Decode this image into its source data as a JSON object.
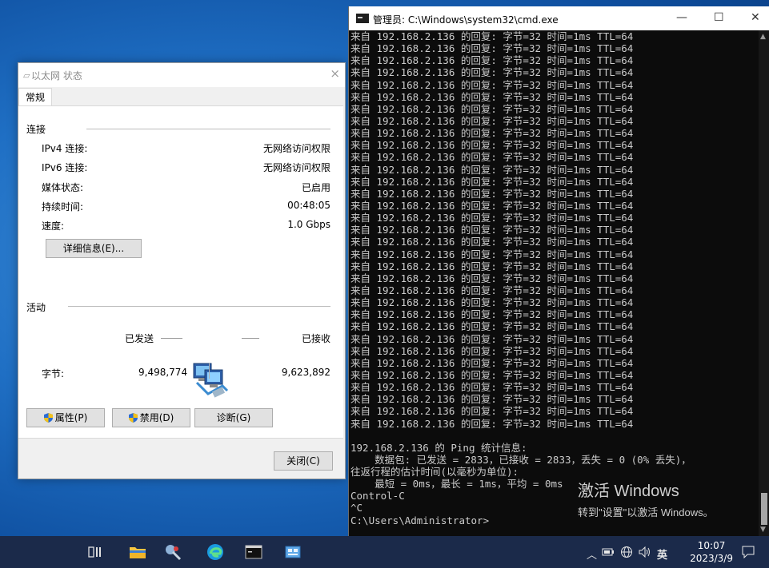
{
  "dialog": {
    "title": "以太网 状态",
    "close_glyph": "×",
    "tab": "常规",
    "connection": {
      "heading": "连接",
      "rows": [
        {
          "label": "IPv4 连接:",
          "value": "无网络访问权限"
        },
        {
          "label": "IPv6 连接:",
          "value": "无网络访问权限"
        },
        {
          "label": "媒体状态:",
          "value": "已启用"
        },
        {
          "label": "持续时间:",
          "value": "00:48:05"
        },
        {
          "label": "速度:",
          "value": "1.0 Gbps"
        }
      ],
      "details_button": "详细信息(E)..."
    },
    "activity": {
      "heading": "活动",
      "sent_label": "已发送",
      "received_label": "已接收",
      "bytes_label": "字节:",
      "bytes_sent": "9,498,774",
      "bytes_received": "9,623,892"
    },
    "buttons": {
      "properties": "属性(P)",
      "disable": "禁用(D)",
      "diagnose": "诊断(G)",
      "close": "关闭(C)"
    }
  },
  "cmd": {
    "title": "管理员: C:\\Windows\\system32\\cmd.exe",
    "controls": {
      "minimize": "—",
      "maximize": "☐",
      "close": "✕"
    },
    "reply_line": "来自 192.168.2.136 的回复: 字节=32 时间=1ms TTL=64",
    "reply_count": 33,
    "tail_lines": [
      "",
      "192.168.2.136 的 Ping 统计信息:",
      "    数据包: 已发送 = 2833，已接收 = 2833，丢失 = 0 (0% 丢失)，",
      "往返行程的估计时间(以毫秒为单位):",
      "    最短 = 0ms，最长 = 1ms，平均 = 0ms",
      "Control-C",
      "^C",
      "C:\\Users\\Administrator>"
    ],
    "watermark_title": "激活 Windows",
    "watermark_sub": "转到\"设置\"以激活 Windows。"
  },
  "taskbar": {
    "icons": [
      "task-view-icon",
      "file-explorer-icon",
      "network-tool-icon",
      "edge-browser-icon",
      "cmd-icon",
      "control-panel-icon"
    ],
    "tray": {
      "chevron": "︿",
      "input_method": "英"
    },
    "time": "10:07",
    "date": "2023/3/9"
  },
  "colors": {
    "console_bg": "#0c0c0c",
    "console_text": "#cccccc",
    "taskbar": "#1b2a4a",
    "desktop": "#1f6fc4",
    "shield_blue": "#2b6cd6",
    "shield_yellow": "#f3c21a"
  }
}
